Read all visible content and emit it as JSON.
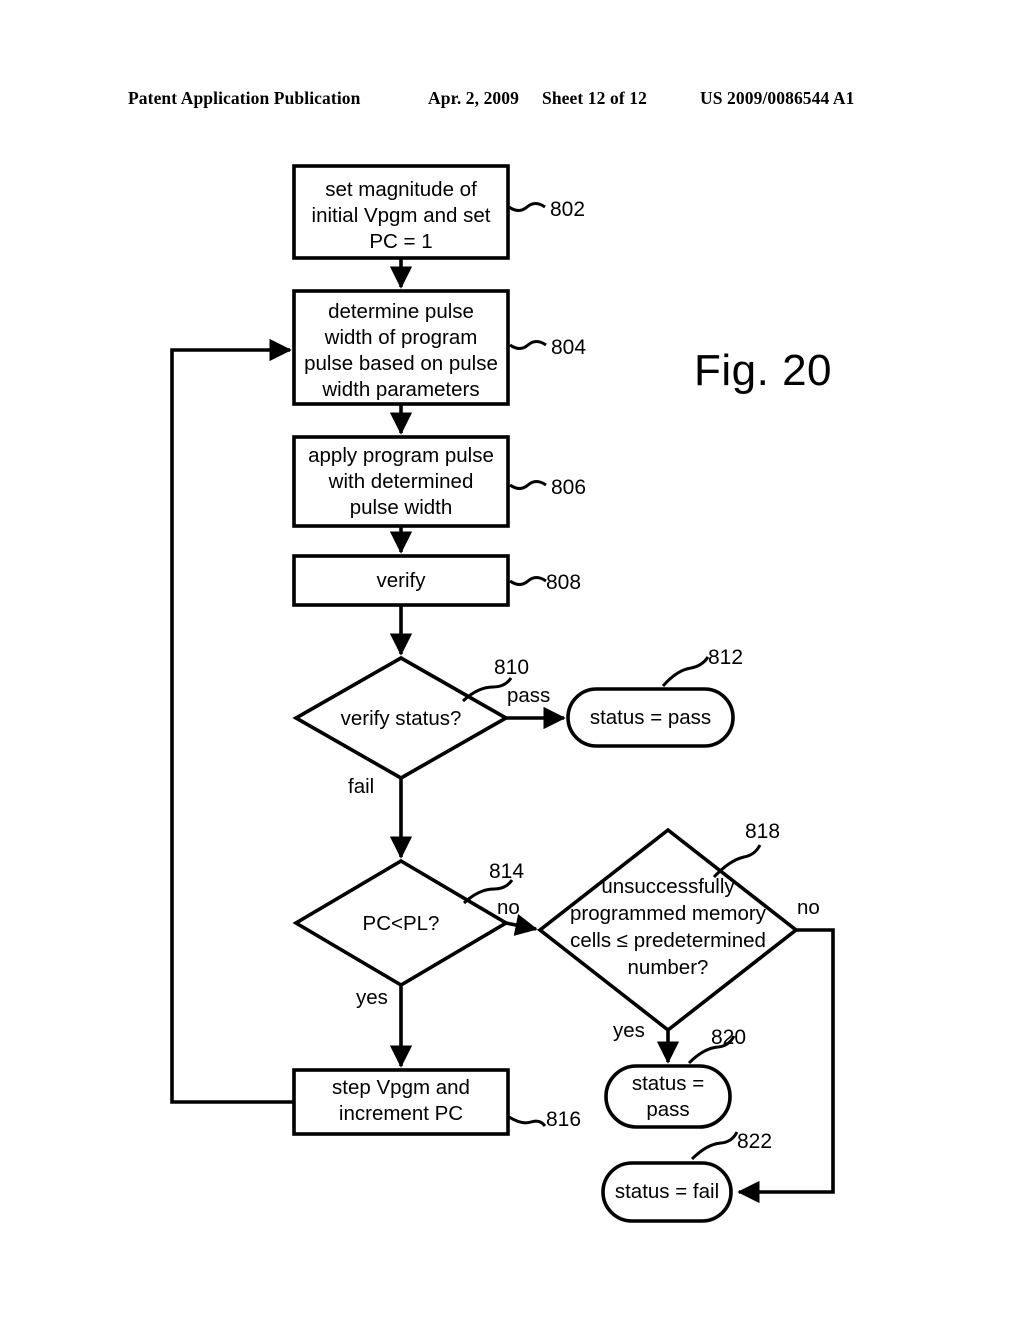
{
  "header": {
    "publication": "Patent Application Publication",
    "date": "Apr. 2, 2009",
    "sheet": "Sheet 12 of 12",
    "patent_number": "US 2009/0086544 A1"
  },
  "figure": {
    "caption": "Fig. 20",
    "ink_color": "#000000",
    "background_color": "#ffffff"
  },
  "nodes": [
    {
      "id": "802",
      "shape": "process",
      "text": "set magnitude of\ninitial Vpgm and set\nPC = 1",
      "ref": "802"
    },
    {
      "id": "804",
      "shape": "process",
      "text": "determine pulse\nwidth of program\npulse based on pulse\nwidth parameters",
      "ref": "804"
    },
    {
      "id": "806",
      "shape": "process",
      "text": "apply program pulse\nwith determined\npulse width",
      "ref": "806"
    },
    {
      "id": "808",
      "shape": "process",
      "text": "verify",
      "ref": "808"
    },
    {
      "id": "810",
      "shape": "decision",
      "text": "verify status?",
      "ref": "810"
    },
    {
      "id": "812",
      "shape": "terminator",
      "text": "status = pass",
      "ref": "812"
    },
    {
      "id": "814",
      "shape": "decision",
      "text": "PC<PL?",
      "ref": "814"
    },
    {
      "id": "816",
      "shape": "process",
      "text": "step Vpgm and\nincrement PC",
      "ref": "816"
    },
    {
      "id": "818",
      "shape": "decision",
      "text": "unsuccessfully\nprogrammed memory\ncells ≤ predetermined\nnumber?",
      "ref": "818"
    },
    {
      "id": "820",
      "shape": "terminator",
      "text": "status =\npass",
      "ref": "820"
    },
    {
      "id": "822",
      "shape": "terminator",
      "text": "status = fail",
      "ref": "822"
    }
  ],
  "edge_labels": {
    "verify_pass": "pass",
    "verify_fail": "fail",
    "pcpl_no": "no",
    "pcpl_yes": "yes",
    "cells_no": "no",
    "cells_yes": "yes"
  }
}
